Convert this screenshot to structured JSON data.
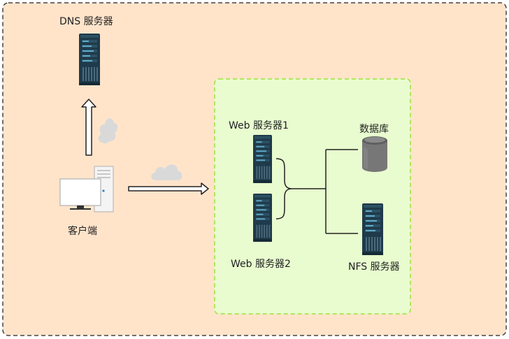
{
  "labels": {
    "dns": "DNS 服务器",
    "client": "客户端",
    "web1": "Web 服务器1",
    "web2": "Web 服务器2",
    "database": "数据库",
    "nfs": "NFS 服务器"
  },
  "colors": {
    "outer_fill": "#FFE4CA",
    "outer_border": "#444444",
    "inner_fill": "#E8FCCF",
    "inner_border": "#9AE43A",
    "server_dark": "#1F3A4A",
    "server_accent": "#5DA9C8",
    "db_gray": "#7A7A7A",
    "cloud": "#D9D9D9"
  },
  "icons": [
    "server-icon",
    "desktop-computer-icon",
    "database-icon",
    "cloud-icon",
    "arrow-up-icon",
    "arrow-right-icon",
    "curly-brace-icon"
  ]
}
